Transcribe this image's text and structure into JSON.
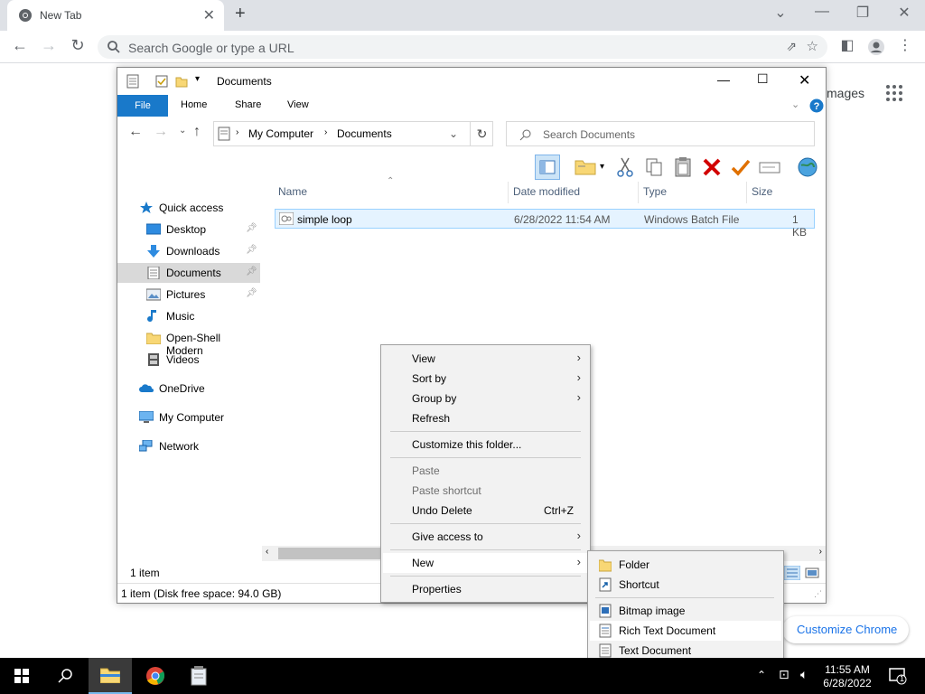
{
  "chrome": {
    "tab_title": "New Tab",
    "omnibox_placeholder": "Search Google or type a URL",
    "ntp_images_partial": "mages",
    "customize_label": "Customize Chrome"
  },
  "explorer": {
    "window_title": "Documents",
    "ribbon_tabs": [
      "File",
      "Home",
      "Share",
      "View"
    ],
    "breadcrumb": [
      "My Computer",
      "Documents"
    ],
    "search_placeholder": "Search Documents",
    "columns": [
      "Name",
      "Date modified",
      "Type",
      "Size"
    ],
    "nav": {
      "quick_access": "Quick access",
      "desktop": "Desktop",
      "downloads": "Downloads",
      "documents": "Documents",
      "pictures": "Pictures",
      "music": "Music",
      "openshell": "Open-Shell Modern",
      "videos": "Videos",
      "onedrive": "OneDrive",
      "mycomputer": "My Computer",
      "network": "Network"
    },
    "file": {
      "name": "simple loop",
      "date": "6/28/2022 11:54 AM",
      "type": "Windows Batch File",
      "size": "1 KB"
    },
    "status_count": "1 item",
    "status_disk": "1 item (Disk free space: 94.0 GB)"
  },
  "context_menu": {
    "view": "View",
    "sort_by": "Sort by",
    "group_by": "Group by",
    "refresh": "Refresh",
    "customize": "Customize this folder...",
    "paste": "Paste",
    "paste_shortcut": "Paste shortcut",
    "undo_delete": "Undo Delete",
    "undo_shortcut": "Ctrl+Z",
    "give_access": "Give access to",
    "new": "New",
    "properties": "Properties"
  },
  "new_submenu": {
    "folder": "Folder",
    "shortcut": "Shortcut",
    "bitmap": "Bitmap image",
    "rtf": "Rich Text Document",
    "text": "Text Document"
  },
  "taskbar": {
    "time": "11:55 AM",
    "date": "6/28/2022",
    "notification_count": "1"
  }
}
